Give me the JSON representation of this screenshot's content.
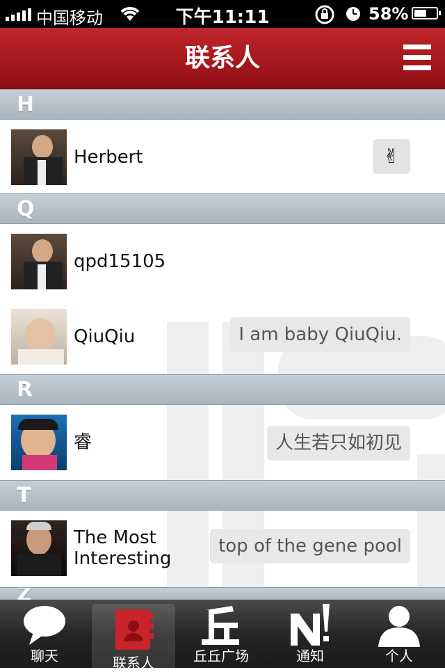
{
  "status_bar": {
    "carrier": "中国移动",
    "time": "下午11:11",
    "battery": "58%",
    "battery_level": 0.58
  },
  "header": {
    "title": "联系人",
    "menu_icon": "menu-icon"
  },
  "sections": [
    {
      "letter": "H",
      "contacts": [
        {
          "name": "Herbert",
          "status": "✌",
          "status_type": "emoji"
        }
      ]
    },
    {
      "letter": "Q",
      "contacts": [
        {
          "name": "qpd15105",
          "status": ""
        },
        {
          "name": "QiuQiu",
          "status": "I am baby QiuQiu."
        }
      ]
    },
    {
      "letter": "R",
      "contacts": [
        {
          "name": "睿",
          "status": "人生若只如初见"
        }
      ]
    },
    {
      "letter": "T",
      "contacts": [
        {
          "name_line1": "The Most",
          "name_line2": "Interesting",
          "status": "top of the gene pool"
        }
      ]
    },
    {
      "letter": "Z"
    }
  ],
  "tab_bar": {
    "tabs": [
      {
        "label": "聊天",
        "icon": "chat-bubble-icon"
      },
      {
        "label": "联系人",
        "icon": "contacts-book-icon",
        "active": true
      },
      {
        "label": "丘丘广场",
        "icon": "plaza-icon"
      },
      {
        "label": "通知",
        "icon": "notification-icon"
      },
      {
        "label": "个人",
        "icon": "person-icon"
      }
    ]
  },
  "colors": {
    "accent": "#b01c21",
    "section_header": "#b3bec8",
    "bubble": "#e8e8e8"
  }
}
